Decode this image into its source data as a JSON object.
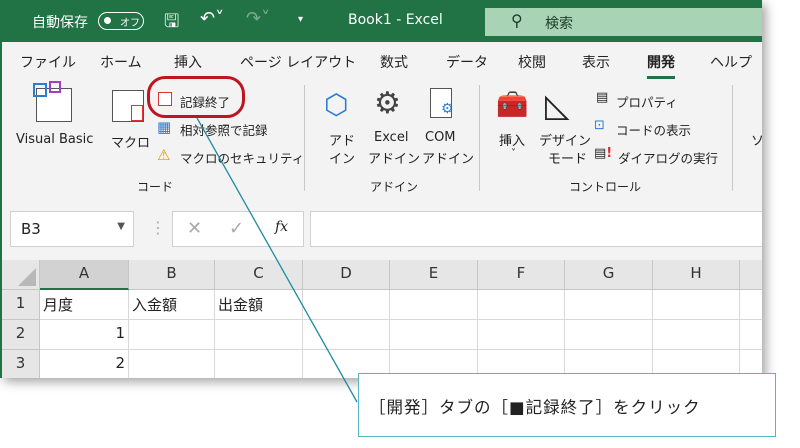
{
  "title_bar": {
    "autosave": "自動保存",
    "autosave_state": "オフ",
    "doc_title": "Book1  -  Excel",
    "search": "検索"
  },
  "tabs": [
    "ファイル",
    "ホーム",
    "挿入",
    "ページ レイアウト",
    "数式",
    "データ",
    "校閲",
    "表示",
    "開発",
    "ヘルプ"
  ],
  "ribbon": {
    "code": {
      "visual_basic": "Visual Basic",
      "macro": "マクロ",
      "stop_recording": "記録終了",
      "relative": "相対参照で記録",
      "security": "マクロのセキュリティ",
      "group": "コード"
    },
    "addins": {
      "addin1": "アド",
      "addin2": "イン",
      "excel1": "Excel",
      "excel2": "アドイン",
      "com1": "COM",
      "com2": "アドイン",
      "group": "アドイン"
    },
    "controls": {
      "insert": "挿入",
      "design1": "デザイン",
      "design2": "モード",
      "properties": "プロパティ",
      "view_code": "コードの表示",
      "run_dialog": "ダイアログの実行",
      "group": "コントロール"
    },
    "source": "ソ"
  },
  "formula_bar": {
    "name_box": "B3",
    "fx": "fx",
    "value": ""
  },
  "sheet": {
    "columns": [
      "A",
      "B",
      "C",
      "D",
      "E",
      "F",
      "G",
      "H"
    ],
    "rows": [
      [
        "月度",
        "入金額",
        "出金額",
        "",
        "",
        "",
        "",
        ""
      ],
      [
        "1",
        "",
        "",
        "",
        "",
        "",
        "",
        ""
      ],
      [
        "2",
        "",
        "",
        "",
        "",
        "",
        "",
        ""
      ]
    ],
    "row_numbers": [
      "1",
      "2",
      "3"
    ]
  },
  "callout": "［開発］タブの［■記録終了］をクリック",
  "colors": {
    "accent": "#217346",
    "highlight": "#c0141e",
    "callout": "#5ab4c4"
  }
}
